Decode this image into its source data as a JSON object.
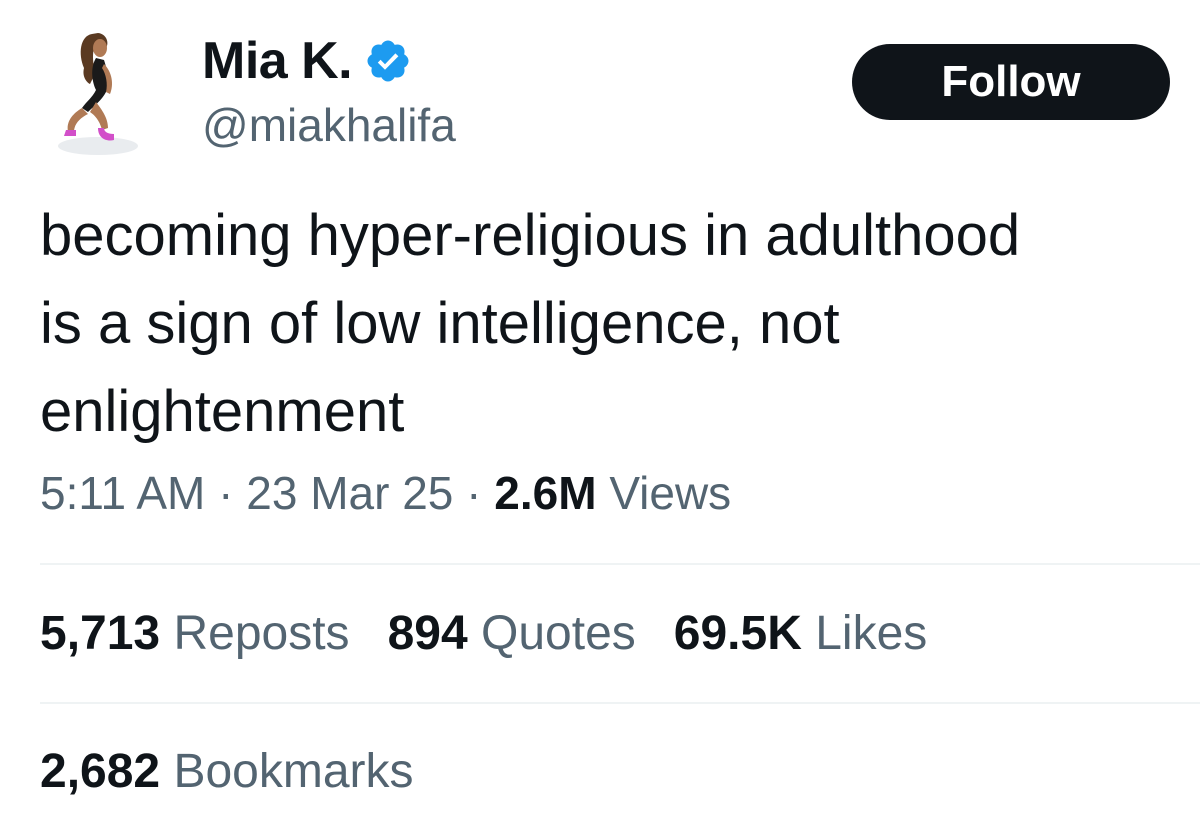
{
  "author": {
    "display_name": "Mia K.",
    "handle": "@miakhalifa",
    "verified": true,
    "avatar_icon": "avatar-figure-icon"
  },
  "follow_button": {
    "label": "Follow"
  },
  "tweet": {
    "text_lines": [
      "becoming hyper-religious in adulthood",
      "is a sign of low intelligence, not",
      "enlightenment"
    ]
  },
  "meta": {
    "time": "5:11 AM",
    "date": "23 Mar 25",
    "separator": "·",
    "views_count": "2.6M",
    "views_label": "Views"
  },
  "stats": {
    "reposts": {
      "count": "5,713",
      "label": "Reposts"
    },
    "quotes": {
      "count": "894",
      "label": "Quotes"
    },
    "likes": {
      "count": "69.5K",
      "label": "Likes"
    },
    "bookmarks": {
      "count": "2,682",
      "label": "Bookmarks"
    }
  },
  "colors": {
    "text_primary": "#0f1419",
    "text_secondary": "#536471",
    "verified_blue": "#1d9bf0",
    "button_bg": "#0f1419",
    "divider": "#eff3f4"
  }
}
